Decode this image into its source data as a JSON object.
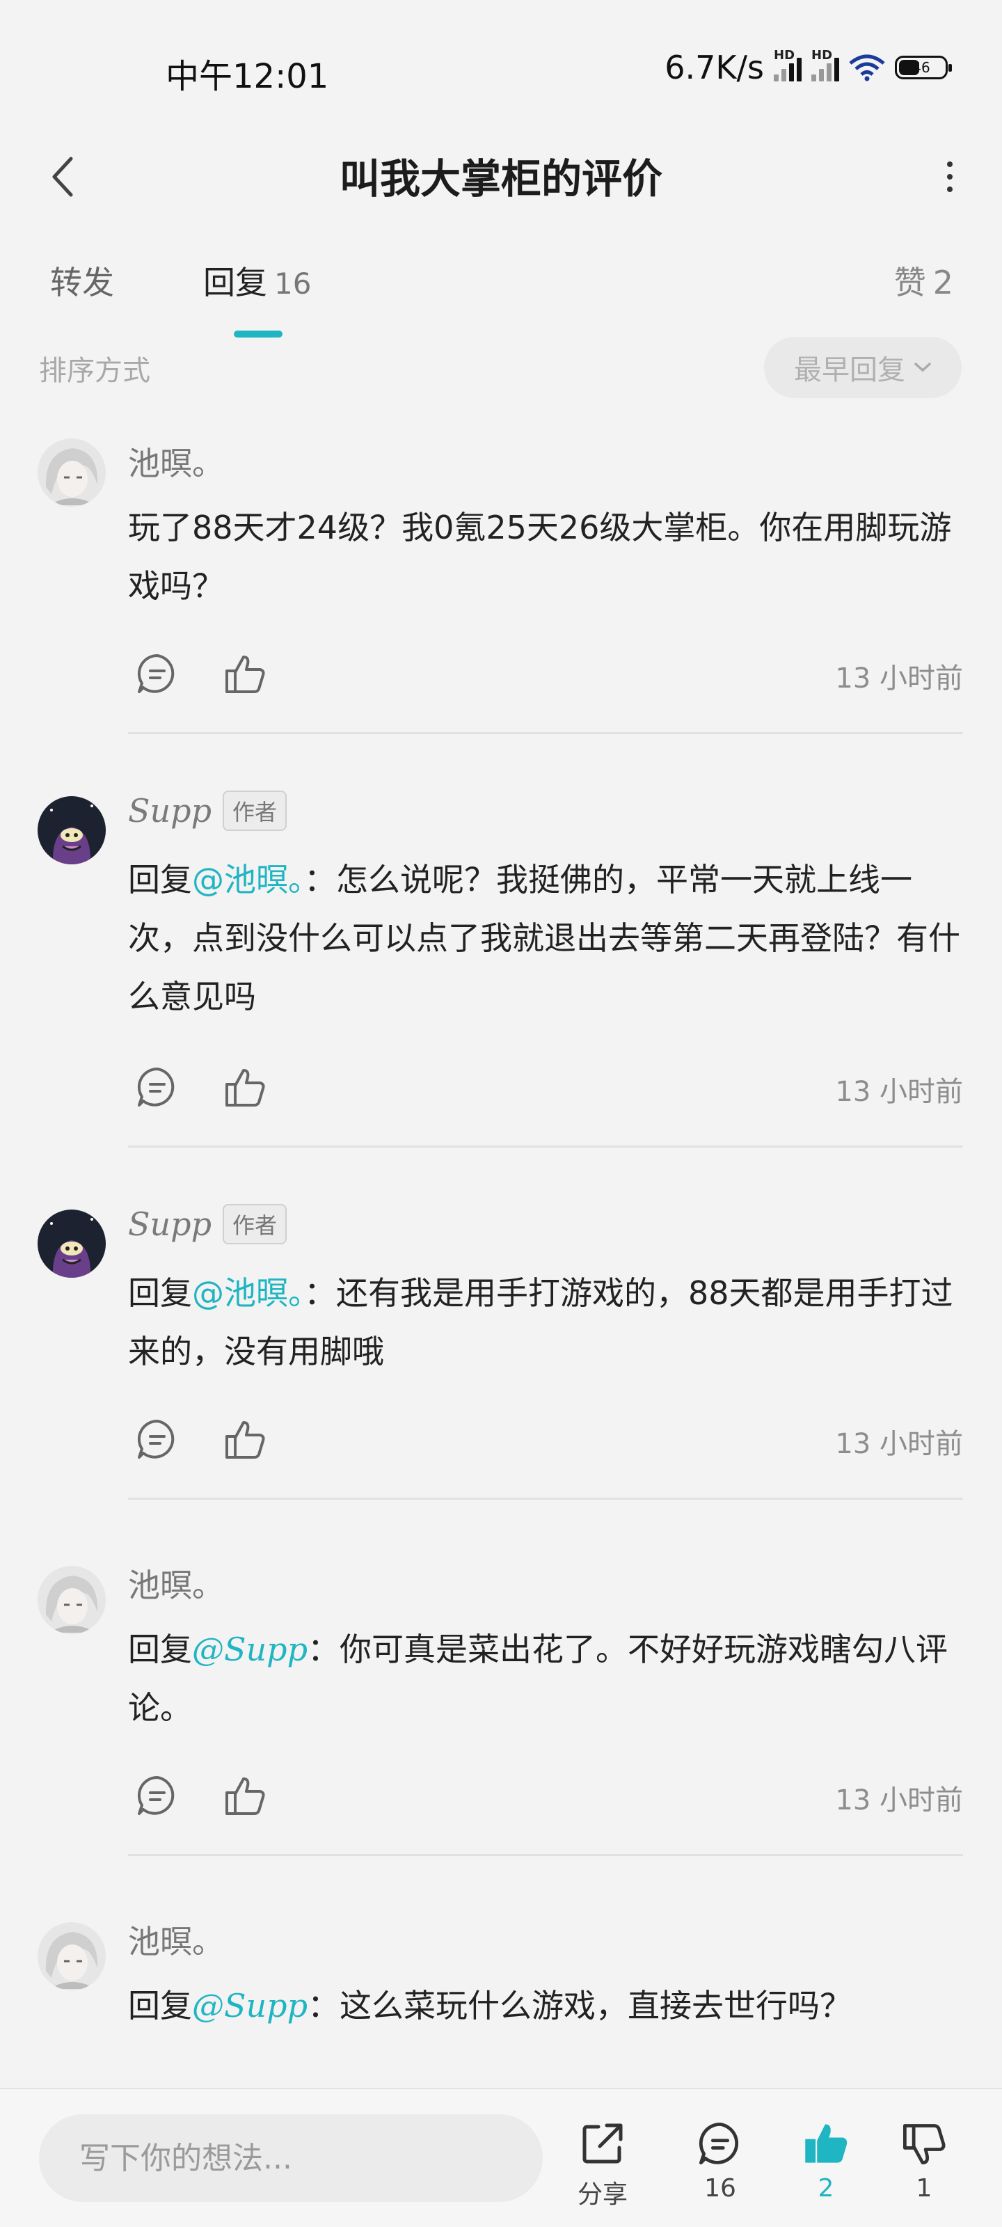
{
  "status_bar": {
    "time": "中午12:01",
    "speed": "6.7K/s",
    "hd1": "HD",
    "hd2": "HD",
    "battery": "46"
  },
  "header": {
    "title": "叫我大掌柜的评价"
  },
  "tabs": {
    "repost_label": "转发",
    "reply_label": "回复",
    "reply_count": "16",
    "like_label": "赞",
    "like_count": "2"
  },
  "sort": {
    "label": "排序方式",
    "selected": "最早回复"
  },
  "comments": [
    {
      "author": "池暝。",
      "text": "玩了88天才24级？我0氪25天26级大掌柜。你在用脚玩游戏吗？",
      "time": "13 小时前"
    },
    {
      "author": "Supp",
      "badge": "作者",
      "reply_prefix": "回复",
      "mention": "@池暝。",
      "text": "：怎么说呢？我挺佛的，平常一天就上线一次，点到没什么可以点了我就退出去等第二天再登陆？有什么意见吗",
      "time": "13 小时前"
    },
    {
      "author": "Supp",
      "badge": "作者",
      "reply_prefix": "回复",
      "mention": "@池暝。",
      "text": "：还有我是用手打游戏的，88天都是用手打过来的，没有用脚哦",
      "time": "13 小时前"
    },
    {
      "author": "池暝。",
      "reply_prefix": "回复",
      "mention": "@Supp",
      "text": "：你可真是菜出花了。不好好玩游戏瞎勾八评论。",
      "time": "13 小时前"
    },
    {
      "author": "池暝。",
      "reply_prefix": "回复",
      "mention": "@Supp",
      "text": "：这么菜玩什么游戏，直接去世行吗？"
    }
  ],
  "bottom_bar": {
    "input_placeholder": "写下你的想法...",
    "share_label": "分享",
    "reply_count": "16",
    "like_count": "2",
    "dislike_count": "1"
  },
  "colors": {
    "accent": "#1fb5c2",
    "background": "#f3f3f3"
  }
}
